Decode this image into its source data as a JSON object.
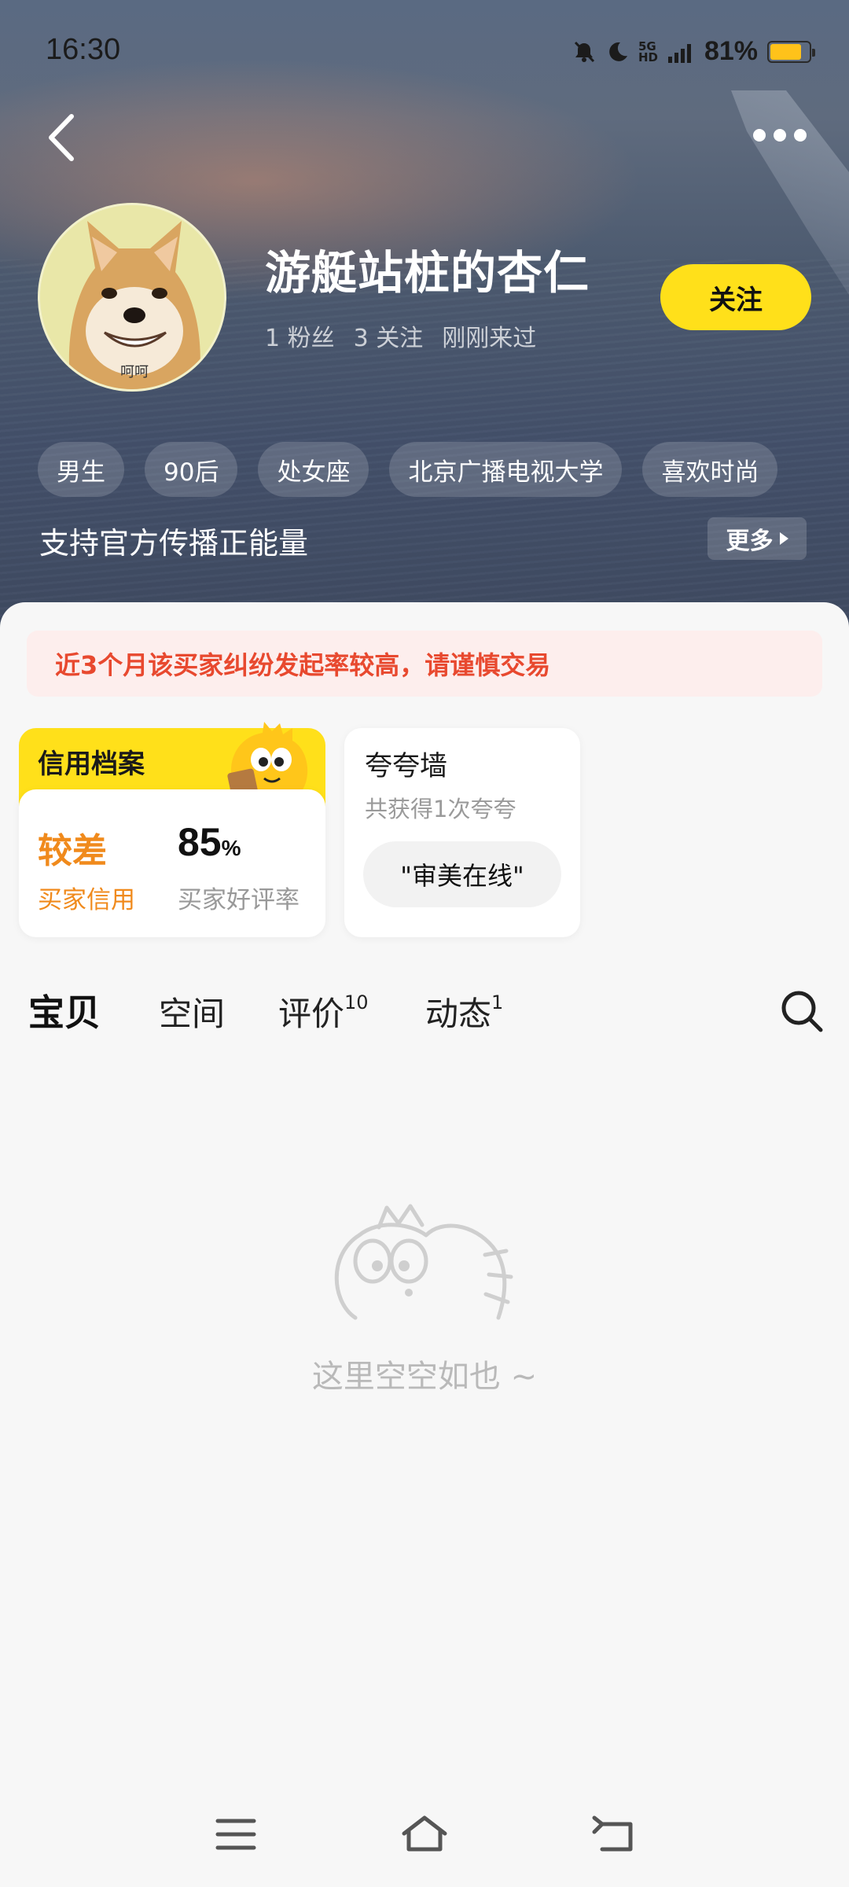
{
  "status_bar": {
    "time": "16:30",
    "network": "5G HD",
    "battery_percent": "81%",
    "battery_level": 0.81,
    "icons": [
      "mute-bell-icon",
      "moon-icon",
      "signal-icon"
    ]
  },
  "header": {
    "back_icon": "chevron-left-icon",
    "more_icon": "more-dots-icon"
  },
  "profile": {
    "avatar_caption": "呵呵",
    "username": "游艇站桩的杏仁",
    "fans": "1 粉丝",
    "following": "3 关注",
    "last_seen": "刚刚来过",
    "follow_label": "关注",
    "tags": [
      "男生",
      "90后",
      "处女座",
      "北京广播电视大学",
      "喜欢时尚"
    ],
    "bio": "支持官方传播正能量",
    "more_label": "更多"
  },
  "warning": "近3个月该买家纠纷发起率较高，请谨慎交易",
  "credit_card": {
    "title": "信用档案",
    "credit_value": "较差",
    "credit_label": "买家信用",
    "rate_value": "85",
    "rate_unit": "%",
    "rate_label": "买家好评率"
  },
  "praise_card": {
    "title": "夸夸墙",
    "subtitle": "共获得1次夸夸",
    "chip": "\"审美在线\""
  },
  "tabs": [
    {
      "label": "宝贝",
      "badge": ""
    },
    {
      "label": "空间",
      "badge": ""
    },
    {
      "label": "评价",
      "badge": "10"
    },
    {
      "label": "动态",
      "badge": "1"
    }
  ],
  "empty_state": "这里空空如也 ~",
  "colors": {
    "accent_yellow": "#ffe01a",
    "warning_red": "#e8492f",
    "credit_orange": "#f08a1c"
  }
}
